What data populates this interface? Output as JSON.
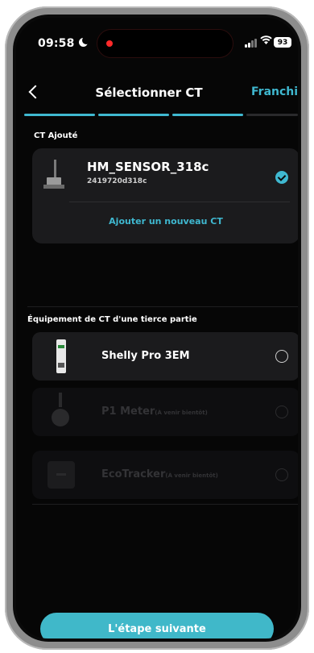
{
  "status": {
    "time": "09:58",
    "battery": "93"
  },
  "header": {
    "title": "Sélectionner CT",
    "skip_label": "Franchir"
  },
  "added_ct": {
    "section_label": "CT Ajouté",
    "device_name": "HM_SENSOR_318c",
    "device_id": "2419720d318c",
    "selected": true,
    "add_new_label": "Ajouter un nouveau CT"
  },
  "third_party": {
    "section_label": "Équipement de CT d'une tierce partie",
    "options": [
      {
        "name": "Shelly Pro 3EM",
        "note": "",
        "available": true
      },
      {
        "name": "P1 Meter",
        "note": "(À venir bientôt)",
        "available": false
      },
      {
        "name": "EcoTracker",
        "note": "(À venir bientôt)",
        "available": false
      }
    ]
  },
  "footer": {
    "next_label": "L'étape suivante"
  },
  "colors": {
    "accent": "#3fb8d0",
    "button": "#40b8c9",
    "background": "#060606",
    "card": "#1b1b1d"
  }
}
